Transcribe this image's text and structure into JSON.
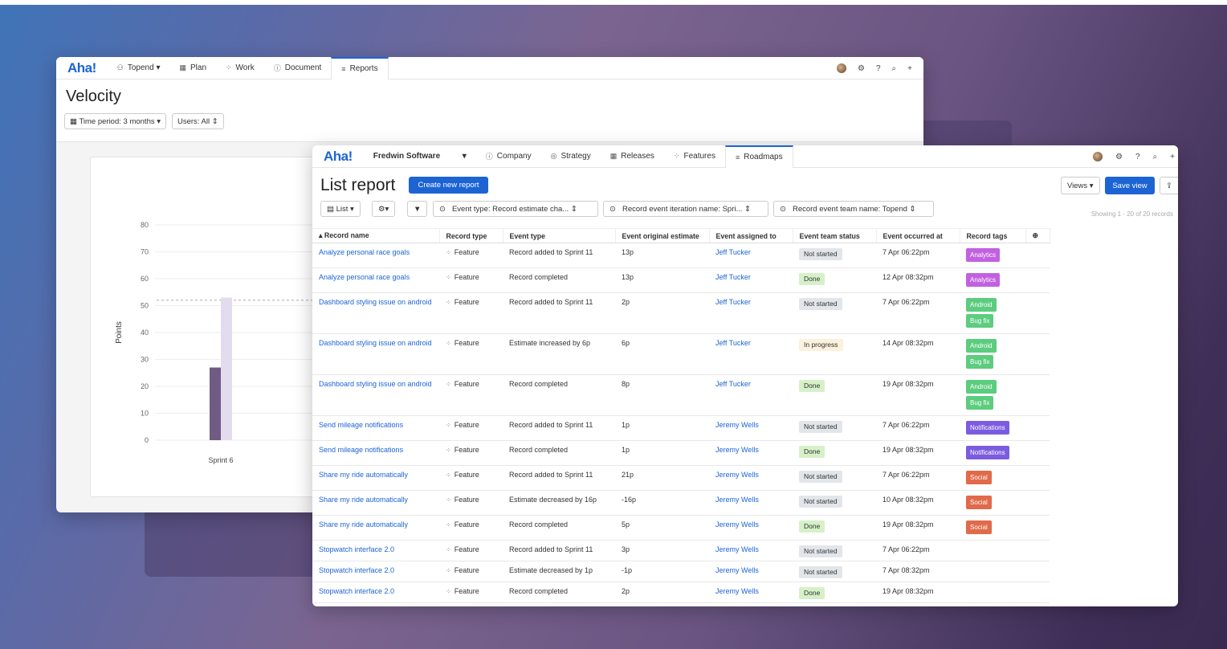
{
  "colors": {
    "brand": "#1c64d4",
    "analytics": "#c261e0",
    "android": "#5ccc7e",
    "bugfix": "#5ccc7e",
    "notifications": "#7b5ce0",
    "social": "#e06a4a"
  },
  "back_window": {
    "logo": "Aha!",
    "nav": [
      {
        "icon": "team-icon",
        "label": "Topend ▾"
      },
      {
        "icon": "calendar-icon",
        "label": "Plan"
      },
      {
        "icon": "grid-icon",
        "label": "Work"
      },
      {
        "icon": "info-icon",
        "label": "Document"
      },
      {
        "icon": "roadmap-icon",
        "label": "Reports"
      }
    ],
    "right_icons": [
      "avatar",
      "gear-icon",
      "help-icon",
      "search-icon",
      "plus-icon"
    ],
    "title": "Velocity",
    "filters": {
      "time_period": "▦ Time period: 3 months ▾",
      "users": "Users: All ⇕"
    },
    "chart": {
      "ylabel": "Points",
      "yticks": [
        "80",
        "70",
        "60",
        "50",
        "40",
        "30",
        "20",
        "10",
        "0"
      ],
      "xtick": "Sprint 6"
    }
  },
  "chart_data": {
    "type": "bar",
    "title": "",
    "xlabel": "",
    "ylabel": "Points",
    "ylim": [
      0,
      80
    ],
    "categories": [
      "Sprint 6"
    ],
    "series": [
      {
        "name": "",
        "values": [
          27
        ],
        "color": "#6f5b84"
      },
      {
        "name": "",
        "values": [
          53
        ],
        "color": "#e2dcee"
      }
    ],
    "reference_line": 52
  },
  "front_window": {
    "logo": "Aha!",
    "workspace": "Fredwin Software",
    "nav": [
      {
        "icon": "info-icon",
        "label": "Company"
      },
      {
        "icon": "target-icon",
        "label": "Strategy"
      },
      {
        "icon": "calendar-icon",
        "label": "Releases"
      },
      {
        "icon": "grid-icon",
        "label": "Features"
      },
      {
        "icon": "roadmap-icon",
        "label": "Roadmaps"
      }
    ],
    "title": "List report",
    "create_button": "Create new report",
    "views_button": "Views ▾",
    "save_button": "Save view",
    "list_button": "▤ List ▾",
    "settings_button": "⚙▾",
    "filter_icon": "▼",
    "filters": [
      "Event type: Record estimate cha... ⇕",
      "Record event iteration name: Spri... ⇕",
      "Record event team name: Topend ⇕"
    ],
    "showing": "Showing 1 - 20 of 20 records",
    "columns": [
      "Record name",
      "Record type",
      "Event type",
      "Event original estimate",
      "Event assigned to",
      "Event team status",
      "Event occurred at",
      "Record tags"
    ],
    "rows": [
      {
        "name": "Analyze personal race goals",
        "type": "Feature",
        "event": "Record added to Sprint 11",
        "est": "13p",
        "who": "Jeff Tucker",
        "status": "Not started",
        "at": "7 Apr 06:22pm",
        "tags": [
          "Analytics"
        ]
      },
      {
        "name": "Analyze personal race goals",
        "type": "Feature",
        "event": "Record completed",
        "est": "13p",
        "who": "Jeff Tucker",
        "status": "Done",
        "at": "12 Apr 08:32pm",
        "tags": [
          "Analytics"
        ]
      },
      {
        "name": "Dashboard styling issue on android",
        "type": "Feature",
        "event": "Record added to Sprint 11",
        "est": "2p",
        "who": "Jeff Tucker",
        "status": "Not started",
        "at": "7 Apr 06:22pm",
        "tags": [
          "Android",
          "Bug fix"
        ]
      },
      {
        "name": "Dashboard styling issue on android",
        "type": "Feature",
        "event": "Estimate increased by 6p",
        "est": "6p",
        "who": "Jeff Tucker",
        "status": "In progress",
        "at": "14 Apr 08:32pm",
        "tags": [
          "Android",
          "Bug fix"
        ]
      },
      {
        "name": "Dashboard styling issue on android",
        "type": "Feature",
        "event": "Record completed",
        "est": "8p",
        "who": "Jeff Tucker",
        "status": "Done",
        "at": "19 Apr 08:32pm",
        "tags": [
          "Android",
          "Bug fix"
        ]
      },
      {
        "name": "Send mileage notifications",
        "type": "Feature",
        "event": "Record added to Sprint 11",
        "est": "1p",
        "who": "Jeremy Wells",
        "status": "Not started",
        "at": "7 Apr 06:22pm",
        "tags": [
          "Notifications"
        ]
      },
      {
        "name": "Send mileage notifications",
        "type": "Feature",
        "event": "Record completed",
        "est": "1p",
        "who": "Jeremy Wells",
        "status": "Done",
        "at": "19 Apr 08:32pm",
        "tags": [
          "Notifications"
        ]
      },
      {
        "name": "Share my ride automatically",
        "type": "Feature",
        "event": "Record added to Sprint 11",
        "est": "21p",
        "who": "Jeremy Wells",
        "status": "Not started",
        "at": "7 Apr 06:22pm",
        "tags": [
          "Social"
        ]
      },
      {
        "name": "Share my ride automatically",
        "type": "Feature",
        "event": "Estimate decreased by 16p",
        "est": "-16p",
        "who": "Jeremy Wells",
        "status": "Not started",
        "at": "10 Apr 08:32pm",
        "tags": [
          "Social"
        ]
      },
      {
        "name": "Share my ride automatically",
        "type": "Feature",
        "event": "Record completed",
        "est": "5p",
        "who": "Jeremy Wells",
        "status": "Done",
        "at": "19 Apr 08:32pm",
        "tags": [
          "Social"
        ]
      },
      {
        "name": "Stopwatch interface 2.0",
        "type": "Feature",
        "event": "Record added to Sprint 11",
        "est": "3p",
        "who": "Jeremy Wells",
        "status": "Not started",
        "at": "7 Apr 06:22pm",
        "tags": []
      },
      {
        "name": "Stopwatch interface 2.0",
        "type": "Feature",
        "event": "Estimate decreased by 1p",
        "est": "-1p",
        "who": "Jeremy Wells",
        "status": "Not started",
        "at": "7 Apr 08:32pm",
        "tags": []
      },
      {
        "name": "Stopwatch interface 2.0",
        "type": "Feature",
        "event": "Record completed",
        "est": "2p",
        "who": "Jeremy Wells",
        "status": "Done",
        "at": "19 Apr 08:32pm",
        "tags": []
      }
    ]
  }
}
